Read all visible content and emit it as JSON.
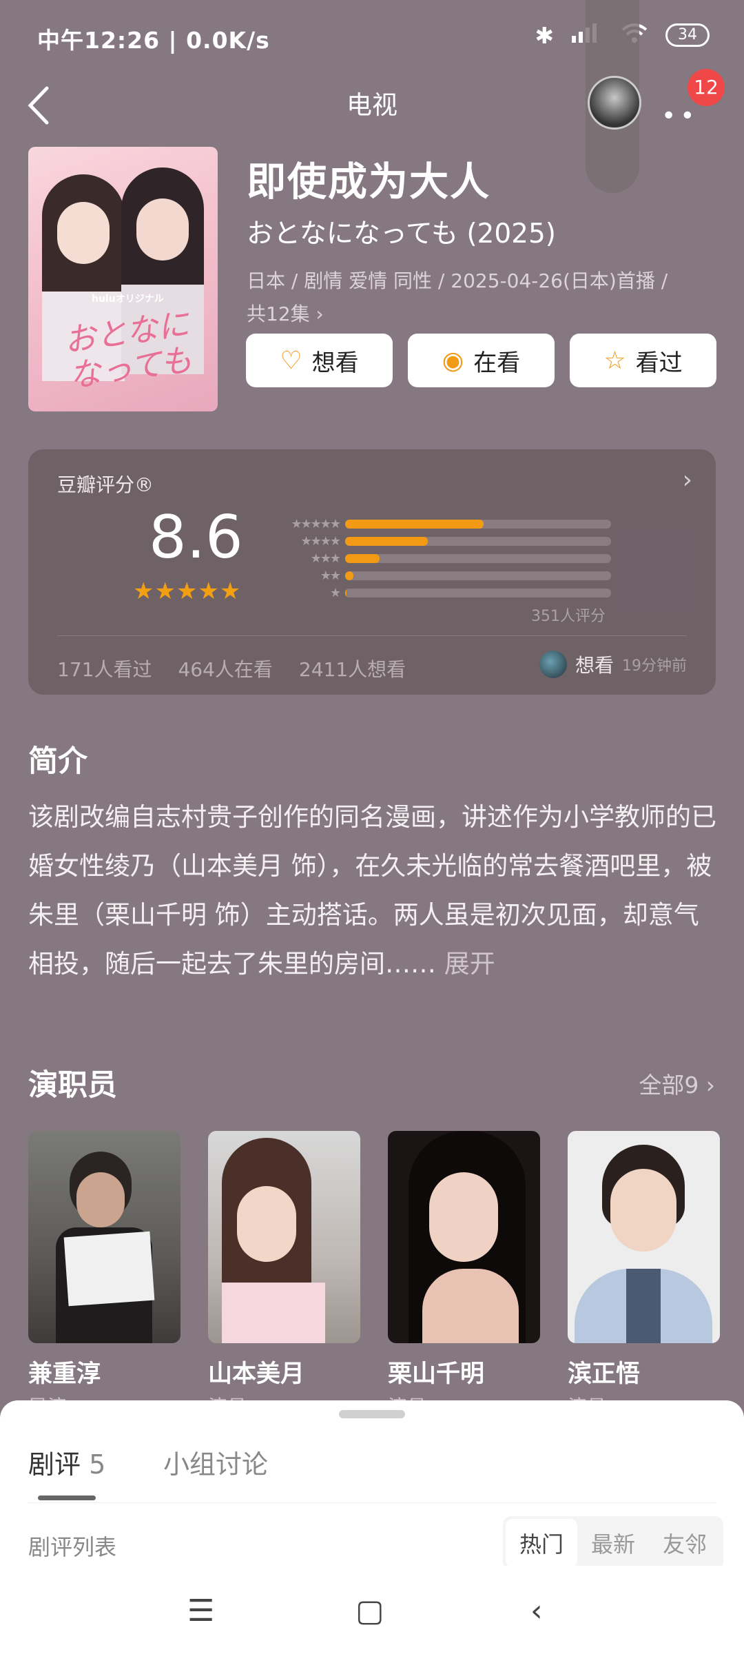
{
  "status_bar": {
    "time": "中午12:26 | 0.0K/s",
    "battery": "34"
  },
  "nav": {
    "title": "电视",
    "notification_count": "12"
  },
  "show": {
    "title_cn": "即使成为大人",
    "title_jp": "おとなになっても (2025)",
    "meta_line1": "日本 / 剧情 爱情 同性 / 2025-04-26(日本)首播 /",
    "meta_line2": "共12集 ›",
    "poster_brand": "huluオリジナル",
    "poster_script": "おとなになっても"
  },
  "actions": [
    {
      "label": "想看",
      "icon": "heart-plus-icon"
    },
    {
      "label": "在看",
      "icon": "target-icon"
    },
    {
      "label": "看过",
      "icon": "star-outline-icon"
    }
  ],
  "rating": {
    "header": "豆瓣评分®",
    "score": "8.6",
    "stars_display": "★★★★★",
    "star_value": 4.5,
    "breakdown": [
      {
        "stars": "★★★★★",
        "fraction": 0.52
      },
      {
        "stars": "★★★★",
        "fraction": 0.31
      },
      {
        "stars": "★★★",
        "fraction": 0.13
      },
      {
        "stars": "★★",
        "fraction": 0.03
      },
      {
        "stars": "★",
        "fraction": 0.005
      }
    ],
    "count_text": "351人评分",
    "watched": "171人看过",
    "watching": "464人在看",
    "want": "2411人想看",
    "activity_verb": "想看",
    "activity_time": "19分钟前"
  },
  "intro": {
    "heading": "简介",
    "text": "该剧改编自志村贵子创作的同名漫画，讲述作为小学教师的已婚女性绫乃（山本美月 饰），在久未光临的常去餐酒吧里，被朱里（栗山千明 饰）主动搭话。两人虽是初次见面，却意气相投，随后一起去了朱里的房间……",
    "expand_label": " 展开"
  },
  "cast": {
    "heading": "演职员",
    "all_label": "全部9 ›",
    "members": [
      {
        "name": "兼重淳",
        "role": "导演"
      },
      {
        "name": "山本美月",
        "role": "演员"
      },
      {
        "name": "栗山千明",
        "role": "演员"
      },
      {
        "name": "滨正悟",
        "role": "演员"
      }
    ]
  },
  "sheet": {
    "tab_reviews": "剧评",
    "tab_reviews_count": " 5",
    "tab_groups": "小组讨论",
    "list_label": "剧评列表",
    "sort_options": [
      "热门",
      "最新",
      "友邻"
    ]
  },
  "colors": {
    "accent": "#f29a14",
    "badge": "#f04848",
    "background": "#857880"
  }
}
